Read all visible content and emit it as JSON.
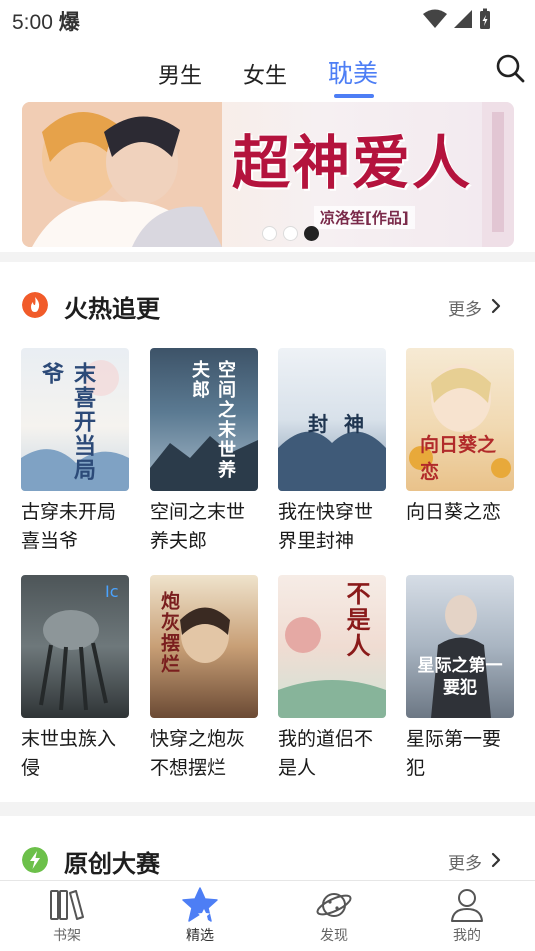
{
  "status_bar": {
    "time": "5:00",
    "notif_icon": "爆"
  },
  "top_tabs": {
    "items": [
      {
        "label": "男生",
        "active": false
      },
      {
        "label": "女生",
        "active": false
      },
      {
        "label": "耽美",
        "active": true
      }
    ],
    "search_icon": "search-icon"
  },
  "banner": {
    "title": "超神爱人",
    "author": "凉洛笙[作品]",
    "slide_count": 3,
    "active_slide": 3
  },
  "section_hot": {
    "title": "火热追更",
    "more_label": "更多",
    "icon": "flame-icon",
    "books": [
      {
        "title": "古穿未开局喜当爷",
        "cover_text": "末喜开当局爷"
      },
      {
        "title": "空间之末世养夫郎",
        "cover_text": "空间之末世养夫郎"
      },
      {
        "title": "我在快穿世界里封神",
        "cover_text": "封神"
      },
      {
        "title": "向日葵之恋",
        "cover_text": "向日葵之恋"
      },
      {
        "title": "末世虫族入侵",
        "cover_text": ""
      },
      {
        "title": "快穿之炮灰不想摆烂",
        "cover_text": "炮灰摆烂"
      },
      {
        "title": "我的道侣不是人",
        "cover_text": "不是人"
      },
      {
        "title": "星际第一要犯",
        "cover_text": "星际之第一要犯"
      }
    ]
  },
  "section_contest": {
    "title": "原创大赛",
    "more_label": "更多",
    "icon": "lightning-icon"
  },
  "bottom_nav": {
    "items": [
      {
        "label": "书架",
        "icon": "bookshelf-icon",
        "active": false
      },
      {
        "label": "精选",
        "icon": "star-icon",
        "active": true
      },
      {
        "label": "发现",
        "icon": "planet-icon",
        "active": false
      },
      {
        "label": "我的",
        "icon": "profile-icon",
        "active": false
      }
    ]
  },
  "colors": {
    "accent": "#4d7ef5",
    "hot_icon": "#f15b2a",
    "contest_icon": "#6cc04a",
    "banner_title": "#b4133d"
  }
}
